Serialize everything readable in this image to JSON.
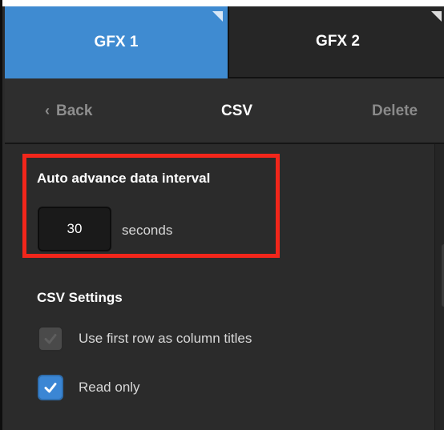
{
  "tabs": [
    {
      "label": "GFX 1",
      "active": true
    },
    {
      "label": "GFX 2",
      "active": false
    }
  ],
  "header": {
    "back_label": "Back",
    "title": "CSV",
    "delete_label": "Delete"
  },
  "auto_advance": {
    "label": "Auto advance data interval",
    "value": "30",
    "unit": "seconds"
  },
  "csv_settings": {
    "label": "CSV Settings",
    "options": [
      {
        "label": "Use first row as column titles",
        "checked": true,
        "disabled": true
      },
      {
        "label": "Read only",
        "checked": true,
        "disabled": false
      }
    ]
  },
  "colors": {
    "active_tab": "#3f8bd1",
    "highlight": "#f2261b",
    "checkbox_checked": "#3b86d4"
  },
  "icons": [
    "chevron-left-icon",
    "checkmark-icon"
  ]
}
